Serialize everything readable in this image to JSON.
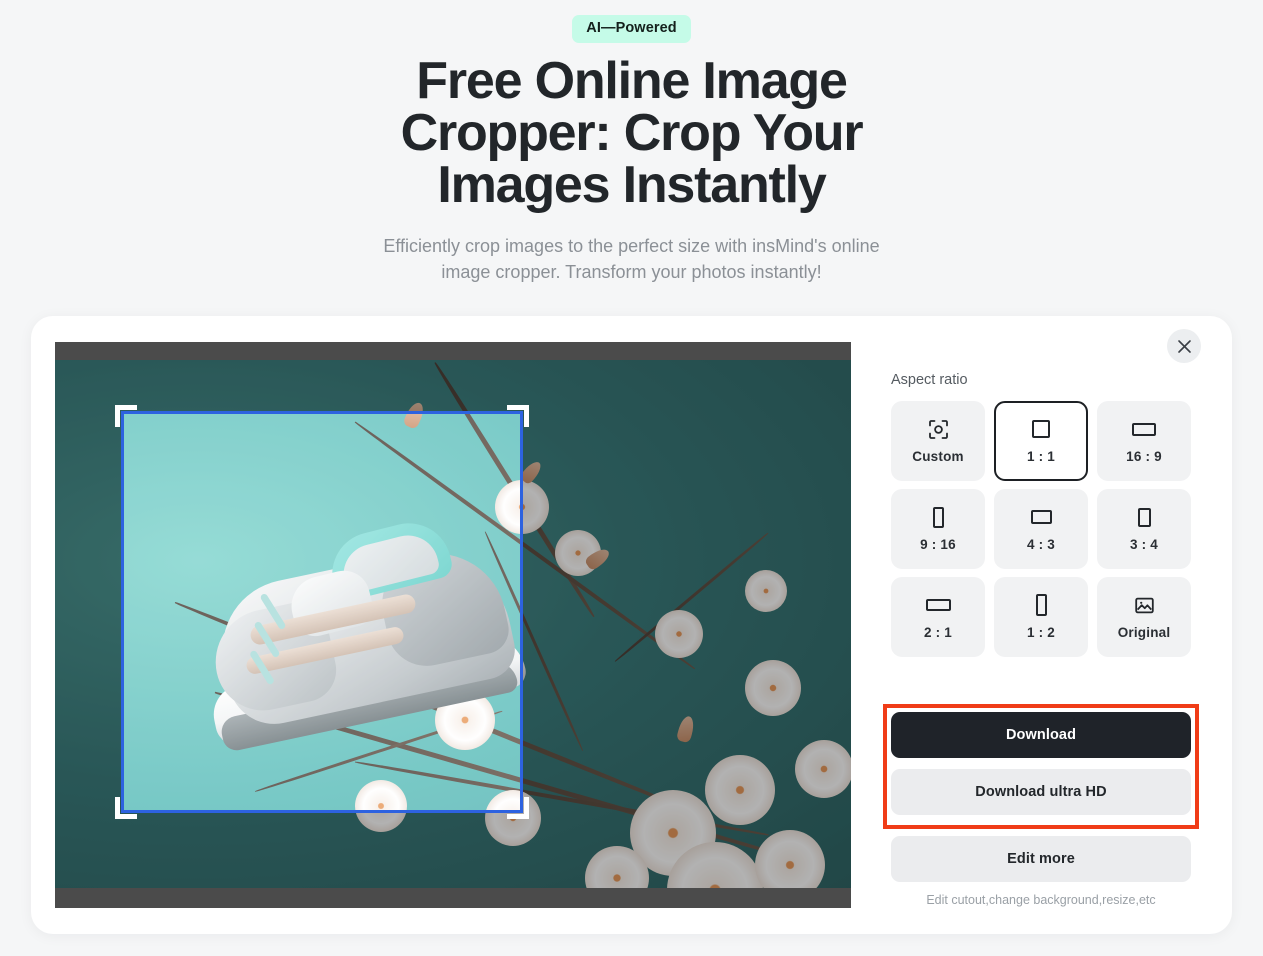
{
  "hero": {
    "badge": "AI—Powered",
    "title": "Free Online Image Cropper: Crop Your Images Instantly",
    "subtitle": "Efficiently crop images to the perfect size with insMind's online image cropper. Transform your photos instantly!"
  },
  "editor": {
    "close_icon": "close-icon",
    "panel_label": "Aspect ratio",
    "ratios": [
      {
        "label": "Custom",
        "icon": "crop-focus-icon",
        "selected": false
      },
      {
        "label": "1 : 1",
        "icon": "square-icon",
        "selected": true
      },
      {
        "label": "16 : 9",
        "icon": "landscape-icon",
        "selected": false
      },
      {
        "label": "9 : 16",
        "icon": "portrait-icon",
        "selected": false
      },
      {
        "label": "4 : 3",
        "icon": "landscape-icon",
        "selected": false
      },
      {
        "label": "3 : 4",
        "icon": "portrait-icon",
        "selected": false
      },
      {
        "label": "2 : 1",
        "icon": "landscape-icon",
        "selected": false
      },
      {
        "label": "1 : 2",
        "icon": "portrait-icon",
        "selected": false
      },
      {
        "label": "Original",
        "icon": "image-icon",
        "selected": false
      }
    ],
    "download_label": "Download",
    "download_hd_label": "Download ultra HD",
    "edit_more_label": "Edit more",
    "edit_more_hint": "Edit cutout,change background,resize,etc"
  },
  "canvas": {
    "photo_description": "Grey and white sneaker with mint accents floating against a teal background with white magnolia blossoms on dark branches",
    "crop_border_color": "#2d62e0",
    "handle_color": "#ffffff"
  },
  "annotation": {
    "highlight_color": "#f03c17",
    "target": "download-buttons"
  },
  "colors": {
    "page_background": "#f5f6f7",
    "card_background": "#ffffff",
    "badge_background": "#c5fbe8",
    "primary_button": "#1f2329",
    "secondary_button": "#ebecee",
    "selected_border": "#1d2024"
  }
}
